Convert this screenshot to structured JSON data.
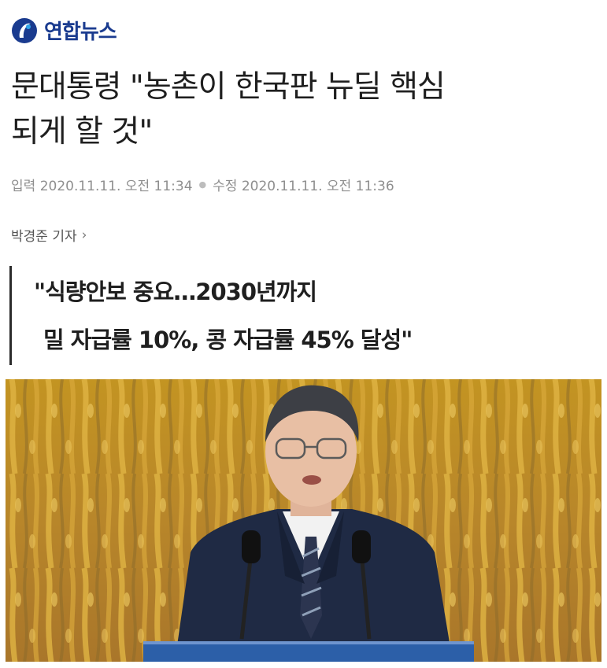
{
  "brand": {
    "name": "연합뉴스",
    "accent": "#1a3b8f"
  },
  "headline": {
    "line1": "문대통령 \"농촌이 한국판 뉴딜 핵심",
    "line2": "되게 할 것\""
  },
  "meta": {
    "input_label": "입력",
    "input_time": "2020.11.11. 오전 11:34",
    "edit_label": "수정",
    "edit_time": "2020.11.11. 오전 11:36"
  },
  "byline": {
    "reporter": "박경준 기자",
    "chevron_icon": "chevron-right-icon"
  },
  "subtitle": {
    "line1": "\"식량안보 중요…2030년까지",
    "line2": "밀 자급률 10%,  콩 자급률 45% 달성\""
  },
  "photo": {
    "subject": "speaker-at-podium",
    "background": "golden-rice-field"
  }
}
